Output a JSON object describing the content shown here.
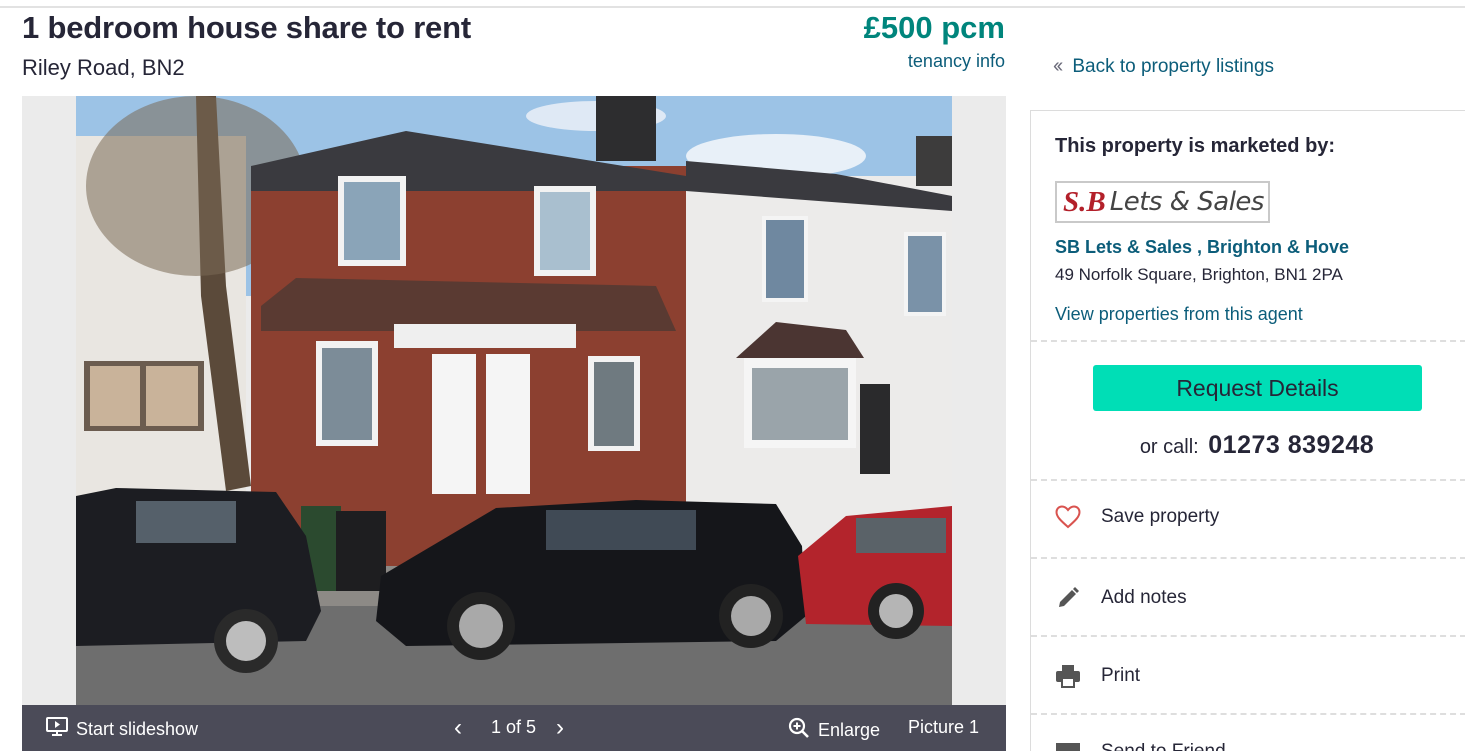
{
  "listing": {
    "title": "1 bedroom house share to rent",
    "address": "Riley Road, BN2",
    "price": "£500 pcm",
    "tenancy_link": "tenancy info"
  },
  "gallery": {
    "slideshow_label": "Start slideshow",
    "counter": "1 of 5",
    "enlarge_label": "Enlarge",
    "picture_label": "Picture 1",
    "prev_glyph": "‹",
    "next_glyph": "›"
  },
  "sidebar": {
    "back_link": "Back to property listings",
    "marketed_by": "This property is marketed by:",
    "logo_sb": "S.B",
    "logo_text": "Lets & Sales",
    "agent_name": "SB Lets & Sales , Brighton & Hove",
    "agent_address": "49 Norfolk Square, Brighton, BN1 2PA",
    "view_properties": "View properties from this agent",
    "request_button": "Request Details",
    "call_prefix": "or call:",
    "phone": "01273 839248",
    "actions": [
      {
        "label": "Save property",
        "icon": "heart-icon"
      },
      {
        "label": "Add notes",
        "icon": "pencil-icon"
      },
      {
        "label": "Print",
        "icon": "printer-icon"
      },
      {
        "label": "Send to Friend",
        "icon": "envelope-icon"
      }
    ]
  },
  "colors": {
    "price": "#00857c",
    "link": "#0c5d7a",
    "button": "#00deb6",
    "heart": "#d9534f",
    "gallery_bar": "#4b4b58"
  }
}
